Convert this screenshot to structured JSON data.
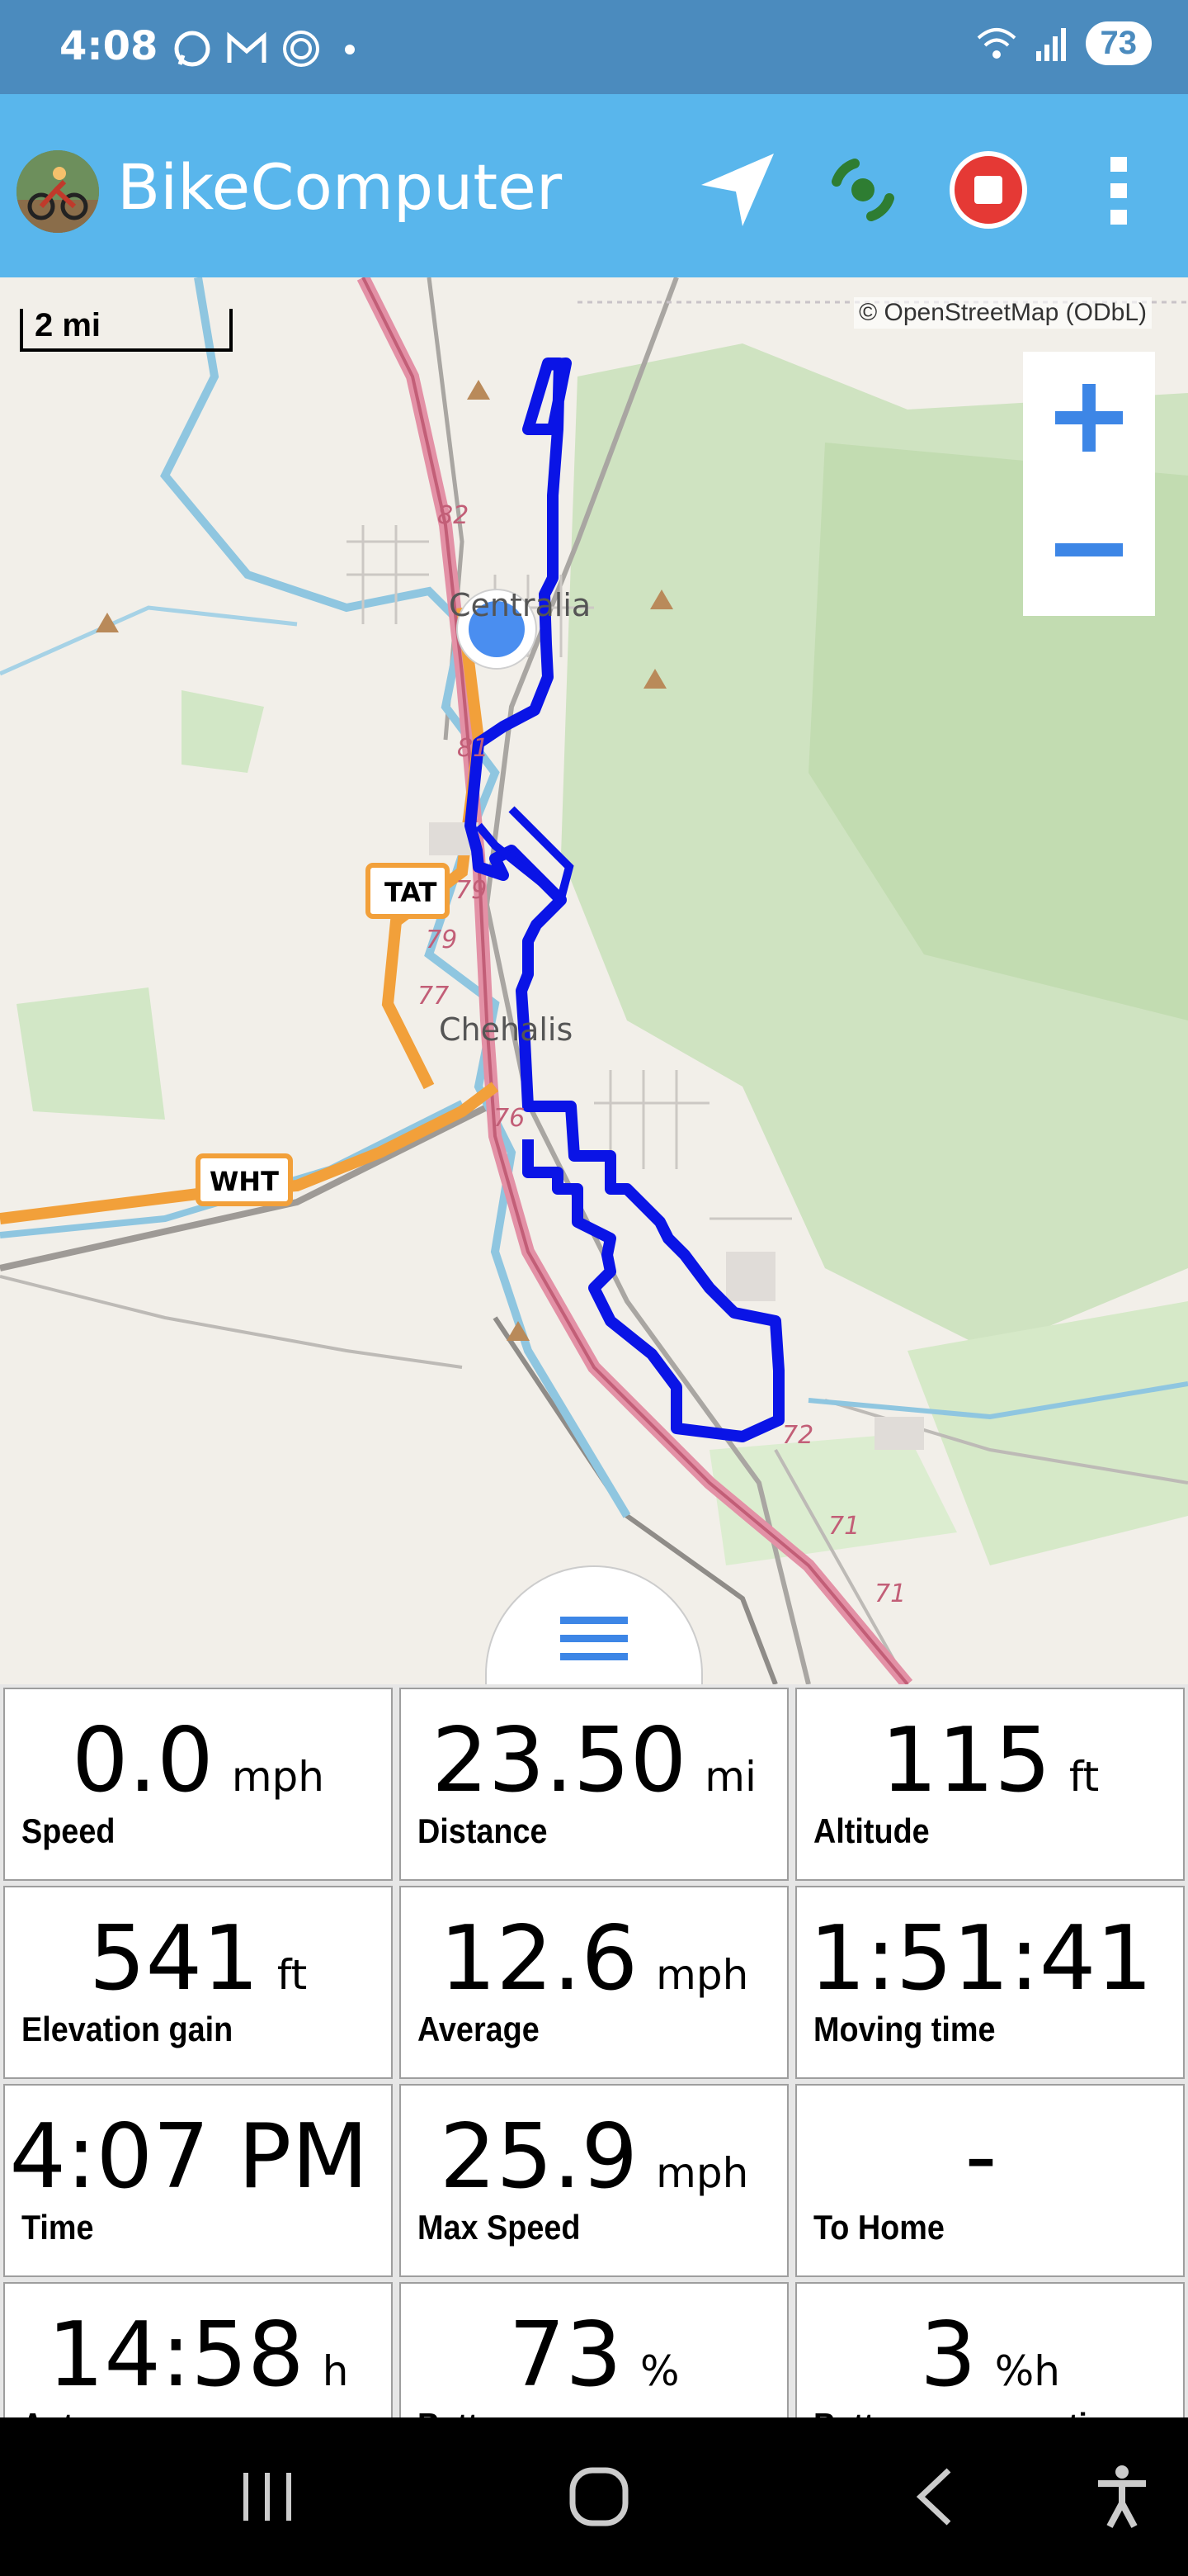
{
  "status_bar": {
    "time": "4:08",
    "battery": "73",
    "icons": [
      "whatsapp-icon",
      "gmail-icon",
      "messenger-icon",
      "dot-icon",
      "wifi-icon",
      "signal-icon"
    ]
  },
  "app_bar": {
    "title": "BikeComputer",
    "actions": [
      "navigate-icon",
      "gps-tracking-icon",
      "stop-record-icon",
      "more-vert-icon"
    ],
    "colors": {
      "bar": "#59b6ec",
      "stop": "#e53935"
    }
  },
  "map": {
    "scale_label": "2 mi",
    "attribution": "© OpenStreetMap (ODbL)",
    "labels": {
      "city_north": "Centralia",
      "city_south": "Chehalis",
      "route_tat": "TAT",
      "route_wht": "WHT",
      "exits": [
        "82",
        "81",
        "79",
        "79",
        "77",
        "76",
        "72",
        "71",
        "71"
      ]
    },
    "track_color": "#0a14e6"
  },
  "stats": [
    {
      "value": "0.0",
      "unit": "mph",
      "label": "Speed"
    },
    {
      "value": "23.50",
      "unit": "mi",
      "label": "Distance"
    },
    {
      "value": "115",
      "unit": "ft",
      "label": "Altitude"
    },
    {
      "value": "541",
      "unit": "ft",
      "label": "Elevation gain"
    },
    {
      "value": "12.6",
      "unit": "mph",
      "label": "Average"
    },
    {
      "value": "1:51:41",
      "unit": "",
      "label": "Moving time"
    },
    {
      "value": "4:07 PM",
      "unit": "",
      "label": "Time"
    },
    {
      "value": "25.9",
      "unit": "mph",
      "label": "Max Speed"
    },
    {
      "value": "-",
      "unit": "",
      "label": "To Home"
    },
    {
      "value": "14:58",
      "unit": "h",
      "label": "Autonomy"
    },
    {
      "value": "73",
      "unit": "%",
      "label": "Battery"
    },
    {
      "value": "3",
      "unit": "%h",
      "label": "Battery consumption"
    }
  ],
  "nav_bar": [
    "recents-icon",
    "home-icon",
    "back-icon",
    "accessibility-icon"
  ]
}
